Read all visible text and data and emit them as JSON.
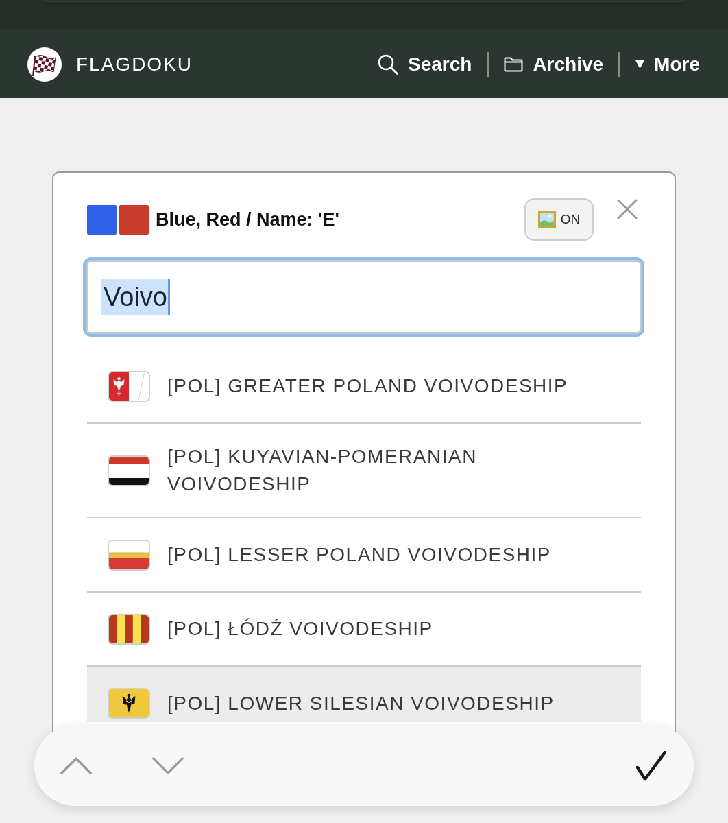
{
  "header": {
    "brand": "FLAGDOKU",
    "links": [
      {
        "kind": "search",
        "label": "Search"
      },
      {
        "kind": "archive",
        "label": "Archive"
      },
      {
        "kind": "more",
        "label": "More"
      }
    ]
  },
  "dialog": {
    "swatches": [
      {
        "color": "#2f62e8"
      },
      {
        "color": "#c83a2a"
      }
    ],
    "title": "Blue, Red / Name: 'E'",
    "image_toggle": {
      "label": "ON"
    },
    "search": {
      "value": "Voivo",
      "text_selected": true
    }
  },
  "results": [
    {
      "kind": "emblem",
      "label": "[POL] GREATER POLAND VOIVODESHIP",
      "selected": false
    },
    {
      "kind": "tricolor",
      "label": "[POL] KUYAVIAN-POMERANIAN VOIVODESHIP",
      "selected": false
    },
    {
      "kind": "bicolor",
      "label": "[POL] LESSER POLAND VOIVODESHIP",
      "selected": false
    },
    {
      "kind": "striped",
      "label": "[POL] ŁÓDŹ VOIVODESHIP",
      "selected": false
    },
    {
      "kind": "crest",
      "label": "[POL] LOWER SILESIAN VOIVODESHIP",
      "selected": true
    }
  ]
}
